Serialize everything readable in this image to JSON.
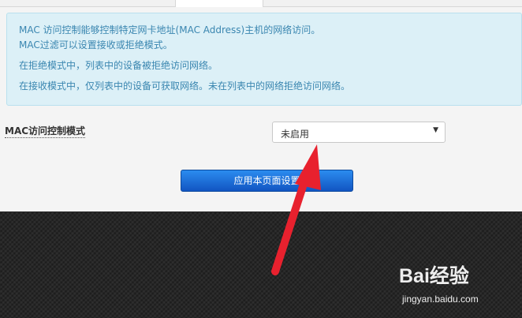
{
  "info": {
    "line1": "MAC 访问控制能够控制特定网卡地址(MAC Address)主机的网络访问。",
    "line2": "MAC过滤可以设置接收或拒绝模式。",
    "line3": "在拒绝模式中，列表中的设备被拒绝访问网络。",
    "line4": "在接收模式中，仅列表中的设备可获取网络。未在列表中的网络拒绝访问网络。"
  },
  "form": {
    "mode_label": "MAC访问控制模式",
    "mode_value": "未启用",
    "apply_label": "应用本页面设置"
  },
  "watermark": {
    "logo_text": "Bai经验",
    "url": "jingyan.baidu.com"
  },
  "colors": {
    "info_text": "#3a86b0",
    "info_bg": "#dcf0f7",
    "button": "#1a6fe0",
    "arrow": "#e8212e",
    "footer": "#272727"
  }
}
